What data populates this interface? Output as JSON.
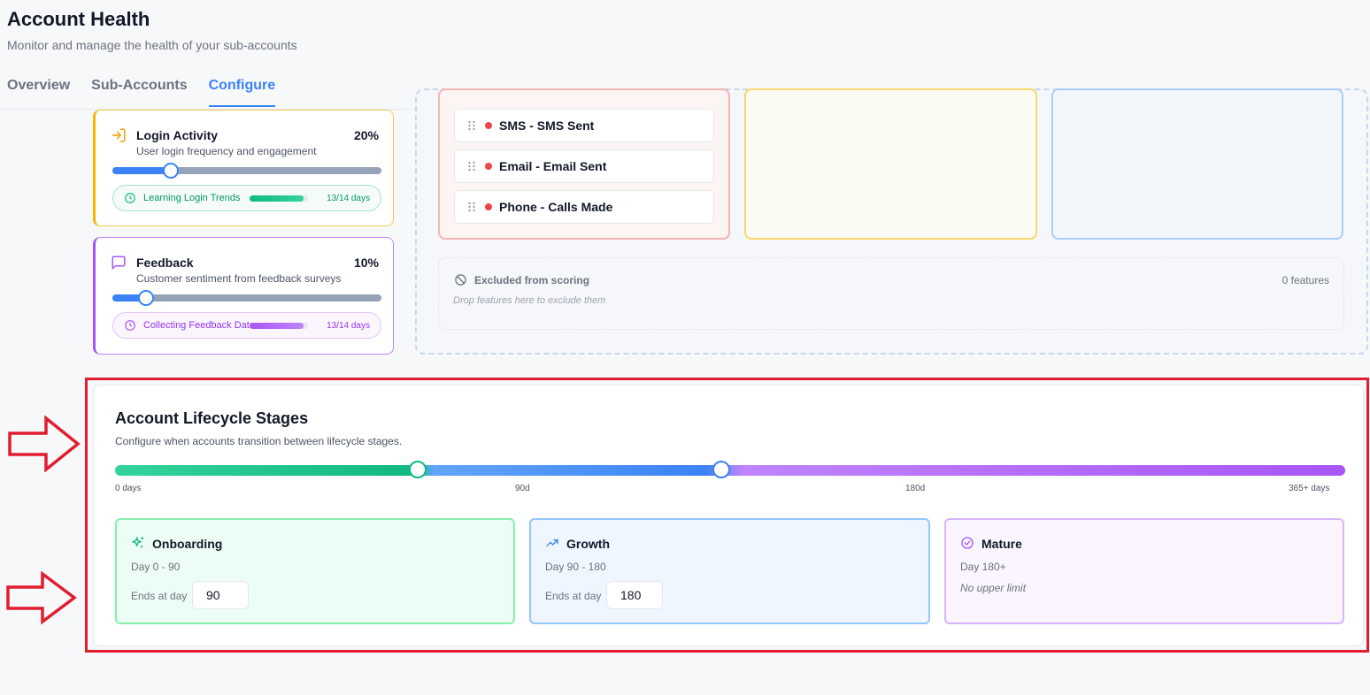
{
  "header": {
    "title": "Account Health",
    "subtitle": "Monitor and manage the health of your sub-accounts",
    "tabs": [
      {
        "label": "Overview",
        "active": false
      },
      {
        "label": "Sub-Accounts",
        "active": false
      },
      {
        "label": "Configure",
        "active": true
      }
    ]
  },
  "features": [
    {
      "title": "Login Activity",
      "description": "User login frequency and engagement",
      "weight": "20%",
      "weight_value": 20,
      "status_label": "Learning Login Trends",
      "status_days": "13/14 days",
      "progress": 0.93,
      "icon": "login-icon",
      "accent": "#f5b400"
    },
    {
      "title": "Feedback",
      "description": "Customer sentiment from feedback surveys",
      "weight": "10%",
      "weight_value": 10,
      "status_label": "Collecting Feedback Data",
      "status_days": "13/14 days",
      "progress": 0.93,
      "icon": "chat-icon",
      "accent": "#a855f7"
    }
  ],
  "bucket_features": [
    {
      "label": "SMS - SMS Sent"
    },
    {
      "label": "Email - Email Sent"
    },
    {
      "label": "Phone - Calls Made"
    }
  ],
  "excluded": {
    "title": "Excluded from scoring",
    "count": "0 features",
    "hint": "Drop features here to exclude them"
  },
  "lifecycle": {
    "title": "Account Lifecycle Stages",
    "subtitle": "Configure when accounts transition between lifecycle stages.",
    "ticks": [
      "0 days",
      "90d",
      "180d",
      "365+ days"
    ],
    "stages": [
      {
        "name": "Onboarding",
        "range": "Day 0 - 90",
        "ends_label": "Ends at day",
        "ends_value": "90",
        "icon": "sparkles-icon"
      },
      {
        "name": "Growth",
        "range": "Day 90 - 180",
        "ends_label": "Ends at day",
        "ends_value": "180",
        "icon": "trending-up-icon"
      },
      {
        "name": "Mature",
        "range": "Day 180+",
        "note": "No upper limit",
        "icon": "check-circle-icon"
      }
    ]
  },
  "colors": {
    "accent": "#3b82f6",
    "highlight": "#e11d2e",
    "onboarding": "#10b981",
    "growth": "#3b82f6",
    "mature": "#a855f7"
  }
}
